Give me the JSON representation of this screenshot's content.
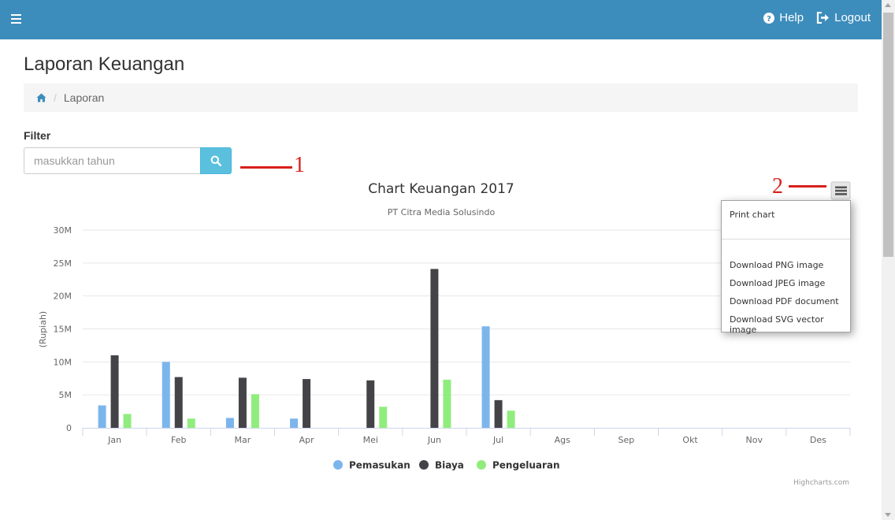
{
  "nav": {
    "help_label": "Help",
    "logout_label": "Logout"
  },
  "page": {
    "title": "Laporan Keuangan",
    "breadcrumb": [
      "Laporan"
    ]
  },
  "filter": {
    "label": "Filter",
    "placeholder": "masukkan tahun"
  },
  "annotations": [
    "1",
    "2"
  ],
  "export_menu": {
    "items": [
      "Print chart",
      "Download PNG image",
      "Download JPEG image",
      "Download PDF document",
      "Download SVG vector image"
    ]
  },
  "chart_data": {
    "type": "bar",
    "title": "Chart Keuangan 2017",
    "subtitle": "PT Citra Media Solusindo",
    "ylabel": "(Rupiah)",
    "xlabel": "",
    "ylim": [
      0,
      30000000
    ],
    "yticks": [
      0,
      5000000,
      10000000,
      15000000,
      20000000,
      25000000,
      30000000
    ],
    "ytick_labels": [
      "0",
      "5M",
      "10M",
      "15M",
      "20M",
      "25M",
      "30M"
    ],
    "grid": true,
    "legend_position": "bottom-center",
    "credits": "Highcharts.com",
    "categories": [
      "Jan",
      "Feb",
      "Mar",
      "Apr",
      "Mei",
      "Jun",
      "Jul",
      "Ags",
      "Sep",
      "Okt",
      "Nov",
      "Des"
    ],
    "series": [
      {
        "name": "Pemasukan",
        "color": "#7cb5ec",
        "values": [
          3400000,
          10000000,
          1500000,
          1400000,
          0,
          0,
          15400000,
          0,
          0,
          0,
          0,
          0
        ]
      },
      {
        "name": "Biaya",
        "color": "#434348",
        "values": [
          11000000,
          7700000,
          7600000,
          7400000,
          7200000,
          24100000,
          4200000,
          0,
          0,
          0,
          0,
          0
        ]
      },
      {
        "name": "Pengeluaran",
        "color": "#90ed7d",
        "values": [
          2100000,
          1400000,
          5100000,
          0,
          3200000,
          7300000,
          2600000,
          0,
          0,
          0,
          0,
          0
        ]
      }
    ]
  }
}
